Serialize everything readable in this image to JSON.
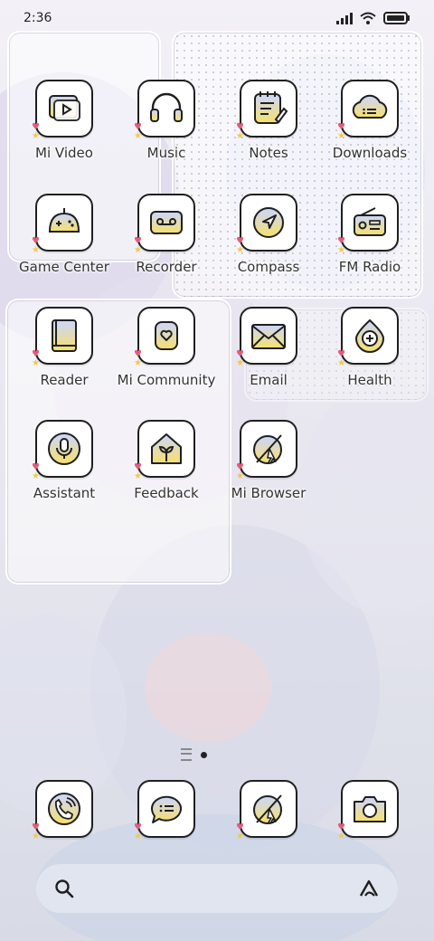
{
  "status_bar": {
    "time": "2:36"
  },
  "apps_page": [
    {
      "label": "Mi Video",
      "icon": "video-player-icon"
    },
    {
      "label": "Music",
      "icon": "headphones-icon"
    },
    {
      "label": "Notes",
      "icon": "notepad-icon"
    },
    {
      "label": "Downloads",
      "icon": "download-cloud-icon"
    },
    {
      "label": "Game Center",
      "icon": "gamepad-icon"
    },
    {
      "label": "Recorder",
      "icon": "tape-recorder-icon"
    },
    {
      "label": "Compass",
      "icon": "compass-arrow-icon"
    },
    {
      "label": "FM Radio",
      "icon": "radio-icon"
    },
    {
      "label": "Reader",
      "icon": "book-icon"
    },
    {
      "label": "Mi Community",
      "icon": "community-heart-icon"
    },
    {
      "label": "Email",
      "icon": "envelope-icon"
    },
    {
      "label": "Health",
      "icon": "health-drop-icon"
    },
    {
      "label": "Assistant",
      "icon": "microphone-icon"
    },
    {
      "label": "Feedback",
      "icon": "feedback-house-icon"
    },
    {
      "label": "Mi Browser",
      "icon": "browser-icon"
    }
  ],
  "dock": [
    {
      "name": "phone",
      "icon": "phone-icon"
    },
    {
      "name": "messages",
      "icon": "chat-bubble-icon"
    },
    {
      "name": "browser",
      "icon": "browser-icon"
    },
    {
      "name": "camera",
      "icon": "camera-icon"
    }
  ],
  "accent_colors": {
    "icon_gradient_top": "#cbd6ff",
    "icon_gradient_bottom": "#f7e06a",
    "outline": "#1f1f1f"
  }
}
